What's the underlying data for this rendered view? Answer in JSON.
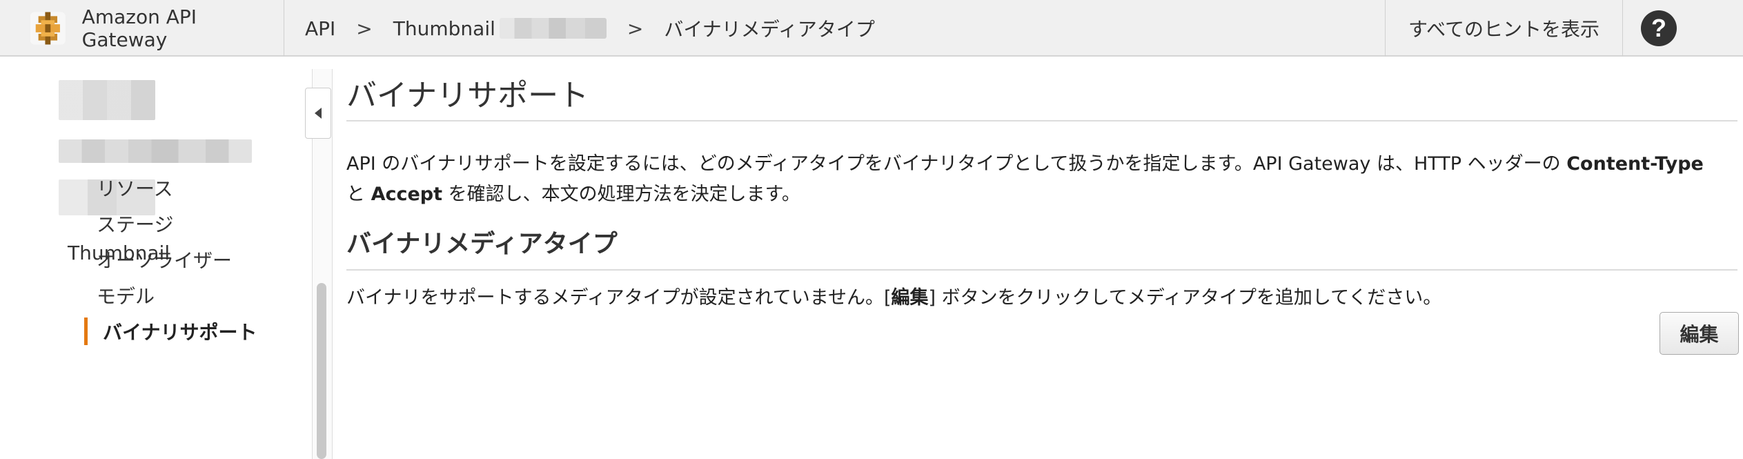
{
  "header": {
    "brand_name": "Amazon API Gateway",
    "breadcrumbs": [
      "API",
      "Thumbnail",
      "バイナリメディアタイプ"
    ],
    "separator": ">",
    "hint_button": "すべてのヒントを表示",
    "help_symbol": "?"
  },
  "sidebar": {
    "api_name": "Thumbnail",
    "items": [
      {
        "label": "リソース"
      },
      {
        "label": "ステージ"
      },
      {
        "label": "オーソライザー"
      },
      {
        "label": "モデル"
      },
      {
        "label": "バイナリサポート",
        "active": true
      }
    ],
    "accent_color": "#e47911"
  },
  "main": {
    "title": "バイナリサポート",
    "description_parts": {
      "p1": "API のバイナリサポートを設定するには、どのメディアタイプをバイナリタイプとして扱うかを指定します。API Gateway は、HTTP ヘッダーの ",
      "content_type": "Content-Type",
      "p2": " と ",
      "accept": "Accept",
      "p3": " を確認し、本文の処理方法を決定します。"
    },
    "section_title": "バイナリメディアタイプ",
    "empty_message": {
      "before": "バイナリをサポートするメディアタイプが設定されていません。[",
      "bold": "編集",
      "after": "] ボタンをクリックしてメディアタイプを追加してください。"
    },
    "edit_button": "編集"
  },
  "icons": {
    "brand_logo": "api-gateway-logo-icon",
    "help": "help-icon",
    "collapse": "collapse-left-icon"
  }
}
